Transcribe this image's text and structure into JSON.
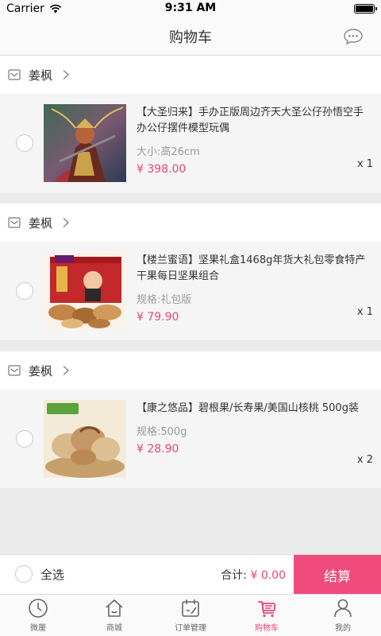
{
  "status": {
    "carrier": "Carrier",
    "time": "9:31 AM"
  },
  "nav": {
    "title": "购物车"
  },
  "shops": [
    {
      "name": "姜枫"
    },
    {
      "name": "姜枫"
    },
    {
      "name": "姜枫"
    }
  ],
  "items": [
    {
      "title": "【大圣归来】手办正版周边齐天大圣公仔孙悟空手办公仔摆件模型玩偶",
      "spec": "大小:高26cm",
      "price": "¥ 398.00",
      "qty": "x 1"
    },
    {
      "title": "【楼兰蜜语】坚果礼盒1468g年货大礼包零食特产干果每日坚果组合",
      "spec": "规格:礼包版",
      "price": "¥ 79.90",
      "qty": "x 1"
    },
    {
      "title": "【康之悠品】碧根果/长寿果/美国山核桃 500g装",
      "spec": "规格:500g",
      "price": "¥ 28.90",
      "qty": "x 2"
    }
  ],
  "footer": {
    "select_all": "全选",
    "total_label": "合计:",
    "total_amount": "¥ 0.00",
    "checkout": "结算"
  },
  "tabs": [
    {
      "label": "微厘",
      "icon": "clock-icon",
      "active": false
    },
    {
      "label": "商城",
      "icon": "home-icon",
      "active": false
    },
    {
      "label": "订单管理",
      "icon": "order-icon",
      "active": false
    },
    {
      "label": "购物车",
      "icon": "cart-icon",
      "active": true
    },
    {
      "label": "我的",
      "icon": "person-icon",
      "active": false
    }
  ],
  "colors": {
    "accent": "#f04b7d",
    "price": "#e8457a"
  }
}
